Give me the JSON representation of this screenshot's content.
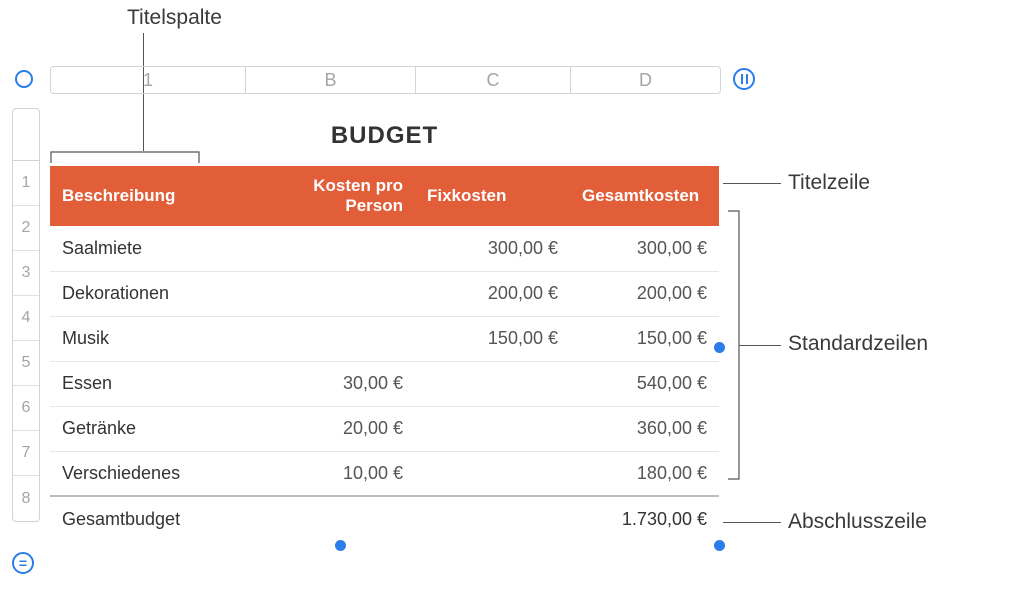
{
  "callouts": {
    "title_column": "Titelspalte",
    "title_row": "Titelzeile",
    "body_rows": "Standardzeilen",
    "footer_row": "Abschlusszeile"
  },
  "columns": {
    "a": "1",
    "b": "B",
    "c": "C",
    "d": "D"
  },
  "rows": [
    "1",
    "2",
    "3",
    "4",
    "5",
    "6",
    "7",
    "8"
  ],
  "table": {
    "title": "BUDGET",
    "headers": {
      "desc": "Beschreibung",
      "per_person": "Kosten pro Person",
      "fixed": "Fixkosten",
      "total": "Gesamtkosten"
    },
    "body": [
      {
        "desc": "Saalmiete",
        "per_person": "",
        "fixed": "300,00 €",
        "total": "300,00 €"
      },
      {
        "desc": "Dekorationen",
        "per_person": "",
        "fixed": "200,00 €",
        "total": "200,00 €"
      },
      {
        "desc": "Musik",
        "per_person": "",
        "fixed": "150,00 €",
        "total": "150,00 €"
      },
      {
        "desc": "Essen",
        "per_person": "30,00 €",
        "fixed": "",
        "total": "540,00 €"
      },
      {
        "desc": "Getränke",
        "per_person": "20,00 €",
        "fixed": "",
        "total": "360,00 €"
      },
      {
        "desc": "Verschiedenes",
        "per_person": "10,00 €",
        "fixed": "",
        "total": "180,00 €"
      }
    ],
    "footer": {
      "desc": "Gesamtbudget",
      "total": "1.730,00 €"
    }
  }
}
